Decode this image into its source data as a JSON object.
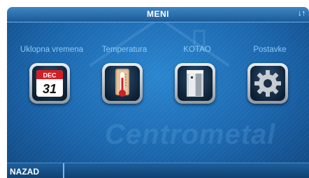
{
  "header": {
    "title": "MENI",
    "status_icon": "signal-arrows-icon"
  },
  "watermark": "Centrometal",
  "tiles": [
    {
      "label": "Uklopna vremena",
      "icon": "calendar-icon",
      "calendar_month": "DEC",
      "calendar_day": "31"
    },
    {
      "label": "Temperatura",
      "icon": "thermometer-icon"
    },
    {
      "label": "KOTAO",
      "icon": "boiler-icon"
    },
    {
      "label": "Postavke",
      "icon": "gear-icon"
    }
  ],
  "footer": {
    "back_label": "NAZAD"
  },
  "colors": {
    "background": "#1b66ad",
    "label": "#8ccaf5",
    "header": "#2b70b0"
  }
}
